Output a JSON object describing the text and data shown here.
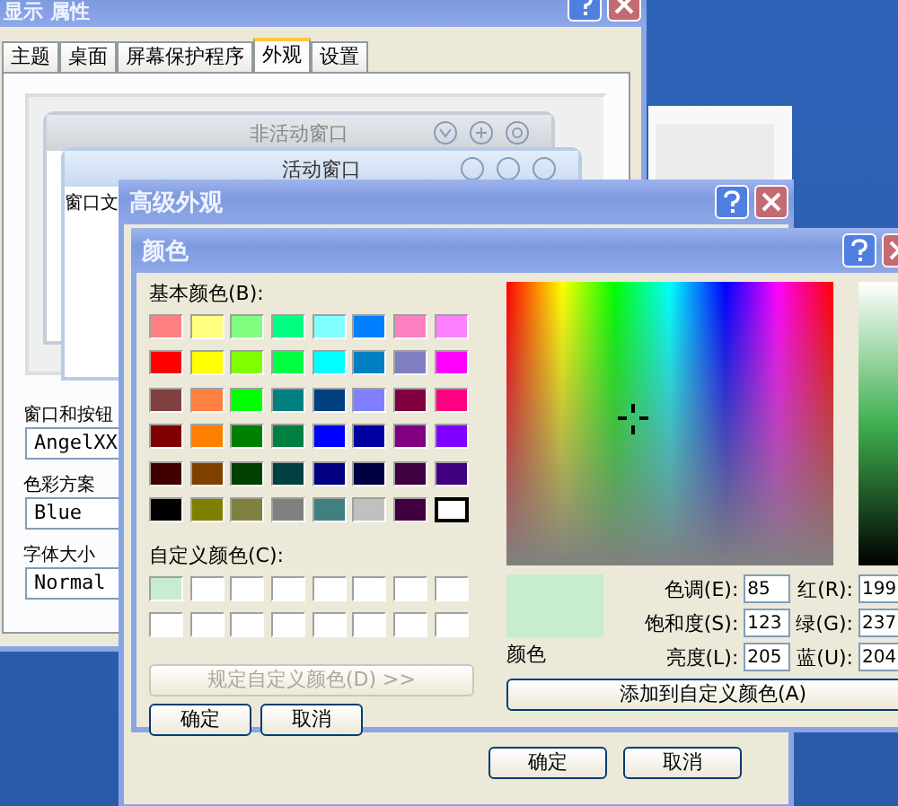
{
  "display_properties": {
    "title": "显示 属性",
    "tabs": [
      {
        "label": "主题",
        "selected": false
      },
      {
        "label": "桌面",
        "selected": false
      },
      {
        "label": "屏幕保护程序",
        "selected": false
      },
      {
        "label": "外观",
        "selected": true
      },
      {
        "label": "设置",
        "selected": false
      }
    ],
    "preview": {
      "inactive_title": "非活动窗口",
      "active_title": "活动窗口",
      "window_text": "窗口文"
    },
    "fields": [
      {
        "label": "窗口和按钮",
        "value": "AngelXX"
      },
      {
        "label": "色彩方案",
        "value": "Blue"
      },
      {
        "label": "字体大小",
        "value": "Normal"
      }
    ]
  },
  "advanced_appearance": {
    "title": "高级外观",
    "buttons": [
      "确定",
      "取消"
    ]
  },
  "color_dialog": {
    "title": "颜色",
    "basic_label": "基本颜色(B):",
    "basic_colors": [
      {
        "color": "#ff8080",
        "selected": false
      },
      {
        "color": "#ffff80",
        "selected": false
      },
      {
        "color": "#80ff80",
        "selected": false
      },
      {
        "color": "#00ff80",
        "selected": false
      },
      {
        "color": "#80ffff",
        "selected": false
      },
      {
        "color": "#0080ff",
        "selected": false
      },
      {
        "color": "#ff80c0",
        "selected": false
      },
      {
        "color": "#ff80ff",
        "selected": false
      },
      {
        "color": "#ff0000",
        "selected": false
      },
      {
        "color": "#ffff00",
        "selected": false
      },
      {
        "color": "#80ff00",
        "selected": false
      },
      {
        "color": "#00ff40",
        "selected": false
      },
      {
        "color": "#00ffff",
        "selected": false
      },
      {
        "color": "#0080c0",
        "selected": false
      },
      {
        "color": "#8080c0",
        "selected": false
      },
      {
        "color": "#ff00ff",
        "selected": false
      },
      {
        "color": "#804040",
        "selected": false
      },
      {
        "color": "#ff8040",
        "selected": false
      },
      {
        "color": "#00ff00",
        "selected": false
      },
      {
        "color": "#008080",
        "selected": false
      },
      {
        "color": "#004080",
        "selected": false
      },
      {
        "color": "#8080ff",
        "selected": false
      },
      {
        "color": "#800040",
        "selected": false
      },
      {
        "color": "#ff0080",
        "selected": false
      },
      {
        "color": "#800000",
        "selected": false
      },
      {
        "color": "#ff8000",
        "selected": false
      },
      {
        "color": "#008000",
        "selected": false
      },
      {
        "color": "#008040",
        "selected": false
      },
      {
        "color": "#0000ff",
        "selected": false
      },
      {
        "color": "#0000a0",
        "selected": false
      },
      {
        "color": "#800080",
        "selected": false
      },
      {
        "color": "#8000ff",
        "selected": false
      },
      {
        "color": "#400000",
        "selected": false
      },
      {
        "color": "#804000",
        "selected": false
      },
      {
        "color": "#004000",
        "selected": false
      },
      {
        "color": "#004040",
        "selected": false
      },
      {
        "color": "#000080",
        "selected": false
      },
      {
        "color": "#000040",
        "selected": false
      },
      {
        "color": "#400040",
        "selected": false
      },
      {
        "color": "#400080",
        "selected": false
      },
      {
        "color": "#000000",
        "selected": false
      },
      {
        "color": "#808000",
        "selected": false
      },
      {
        "color": "#808040",
        "selected": false
      },
      {
        "color": "#808080",
        "selected": false
      },
      {
        "color": "#408080",
        "selected": false
      },
      {
        "color": "#c0c0c0",
        "selected": false
      },
      {
        "color": "#400040",
        "selected": false
      },
      {
        "color": "#ffffff",
        "selected": true
      }
    ],
    "custom_label": "自定义颜色(C):",
    "custom_colors": [
      {
        "color": "#c8ecd0"
      },
      {
        "color": "#ffffff"
      },
      {
        "color": "#ffffff"
      },
      {
        "color": "#ffffff"
      },
      {
        "color": "#ffffff"
      },
      {
        "color": "#ffffff"
      },
      {
        "color": "#ffffff"
      },
      {
        "color": "#ffffff"
      },
      {
        "color": "#ffffff"
      },
      {
        "color": "#ffffff"
      },
      {
        "color": "#ffffff"
      },
      {
        "color": "#ffffff"
      },
      {
        "color": "#ffffff"
      },
      {
        "color": "#ffffff"
      },
      {
        "color": "#ffffff"
      },
      {
        "color": "#ffffff"
      }
    ],
    "define_button": {
      "label": "规定自定义颜色(D) >>",
      "disabled": true
    },
    "buttons": [
      "确定",
      "取消"
    ],
    "preview_label": "颜色",
    "hsl_fields": [
      {
        "label": "色调(E):",
        "value": "85"
      },
      {
        "label": "饱和度(S):",
        "value": "123"
      },
      {
        "label": "亮度(L):",
        "value": "205"
      }
    ],
    "rgb_fields": [
      {
        "label": "红(R):",
        "value": "199"
      },
      {
        "label": "绿(G):",
        "value": "237"
      },
      {
        "label": "蓝(U):",
        "value": "204"
      }
    ],
    "add_button": "添加到自定义颜色(A)"
  }
}
